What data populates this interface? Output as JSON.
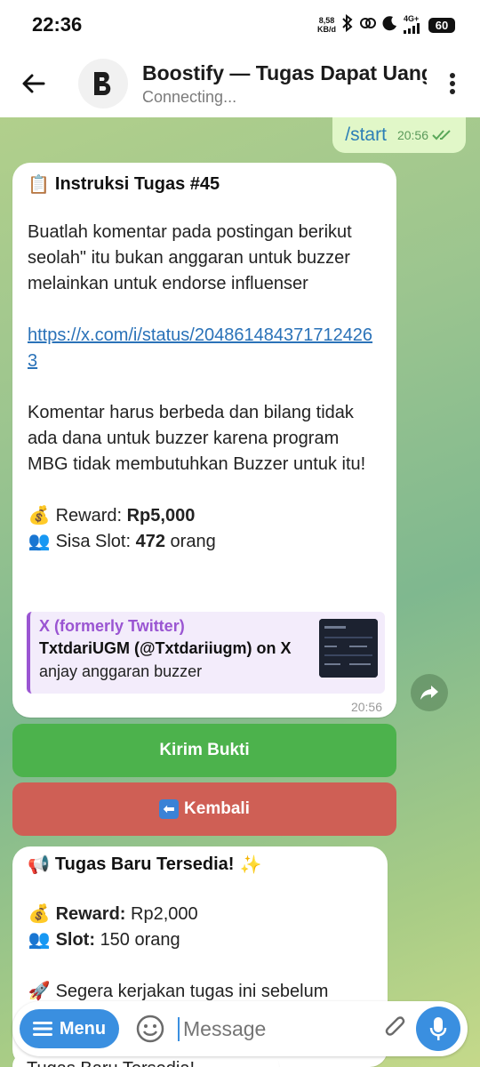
{
  "status_bar": {
    "time": "22:36",
    "net_speed_value": "8,58",
    "net_speed_unit": "KB/d",
    "network": "4G+",
    "battery": "60"
  },
  "header": {
    "title": "Boostify — Tugas Dapat Uang",
    "subtitle": "Connecting..."
  },
  "outgoing": {
    "text": "/start",
    "time": "20:56"
  },
  "task_message": {
    "title": "Instruksi Tugas #45",
    "title_emoji": "📋",
    "instruction": "Buatlah komentar pada postingan berikut seolah\" itu bukan anggaran untuk buzzer melainkan untuk endorse influenser",
    "link": "https://x.com/i/status/2048614843717124263",
    "note": "Komentar harus berbeda dan bilang tidak ada dana untuk buzzer karena program MBG tidak membutuhkan Buzzer untuk itu!",
    "reward_emoji": "💰",
    "reward_label": "Reward:",
    "reward_value": "Rp5,000",
    "slot_emoji": "👥",
    "slot_label": "Sisa Slot:",
    "slot_value": "472",
    "slot_unit": "orang",
    "preview": {
      "site": "X (formerly Twitter)",
      "title": "TxtdariUGM (@Txtdariiugm) on X",
      "description": "anjay anggaran buzzer"
    },
    "time": "20:56"
  },
  "buttons": {
    "kirim": "Kirim Bukti",
    "kembali": "Kembali",
    "kembali_icon": "⬅"
  },
  "new_task_message": {
    "title_emoji": "📢",
    "title": "Tugas Baru Tersedia!",
    "title_suffix": "✨",
    "reward_emoji": "💰",
    "reward_label": "Reward:",
    "reward_value": "Rp2,000",
    "slot_emoji": "👥",
    "slot_label": "Slot:",
    "slot_value": "150 orang",
    "hint_emoji": "🚀",
    "hint": "Segera kerjakan tugas ini sebelum"
  },
  "next_message": {
    "title": "Tugas Baru Tersedia!"
  },
  "input_bar": {
    "menu_label": "Menu",
    "placeholder": "Message"
  },
  "colors": {
    "accent": "#3a8fe0",
    "kirim_green": "#4cb24c",
    "kembali_red": "#cf5f55",
    "link": "#2a72b8",
    "preview_purple": "#9a55d2"
  }
}
